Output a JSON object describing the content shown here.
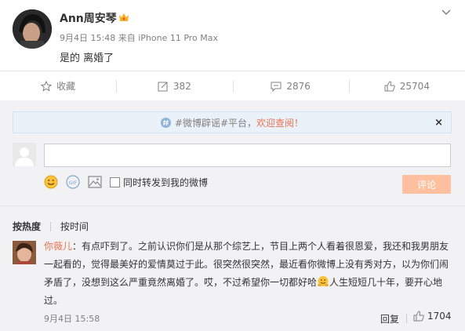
{
  "post": {
    "username": "Ann周安琴",
    "date": "9月4日 15:48",
    "source_prefix": "来自",
    "source": "iPhone 11 Pro Max",
    "text": "是的 离婚了"
  },
  "actions": [
    {
      "label": "收藏",
      "icon": "star-icon"
    },
    {
      "label": "382",
      "icon": "share-icon"
    },
    {
      "label": "2876",
      "icon": "comment-icon"
    },
    {
      "label": "25704",
      "icon": "like-icon"
    }
  ],
  "notice": {
    "text": "#微博辟谣#平台，",
    "highlight": "欢迎查阅！",
    "close": "×"
  },
  "composer": {
    "forward_label": "同时转发到我的微博",
    "submit_label": "评论"
  },
  "sort": {
    "hot": "按热度",
    "time": "按时间"
  },
  "comment": {
    "name": "你薇儿",
    "text_a": "：有点吓到了。之前认识你们是从那个综艺上，节目上两个人看着很恩爱，我还和我男朋友一起看的，觉得最美好的爱情莫过于此。很突然很突然，最近看你微博上没有秀对方，以为你们闹矛盾了，没想到这么严重竟然离婚了。哎，不过希望你一切都好哈",
    "text_b": "人生短短几十年，要开心地过。",
    "time": "9月4日 15:58",
    "reply": "回复",
    "likes": "1704"
  },
  "colors": {
    "accent": "#eb7350",
    "submit_disabled": "#ffc09f",
    "muted": "#808080"
  }
}
